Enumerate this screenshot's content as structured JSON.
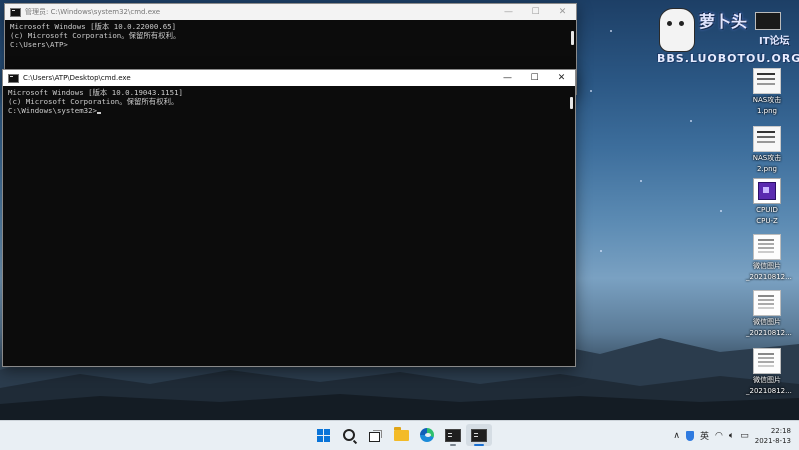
{
  "desktop": {
    "logo": {
      "title": "萝卜头",
      "forum": "IT论坛",
      "url": "BBS.LUOBOTOU.ORG"
    },
    "icons": [
      {
        "label_line1": "NAS攻击",
        "label_line2": "1.png",
        "type": "nas"
      },
      {
        "label_line1": "NAS攻击",
        "label_line2": "2.png",
        "type": "nas"
      },
      {
        "label_line1": "CPUID",
        "label_line2": "CPU-Z",
        "type": "cpu"
      },
      {
        "label_line1": "微信图片",
        "label_line2": "_20210812...",
        "type": "doc"
      },
      {
        "label_line1": "微信图片",
        "label_line2": "_20210812...",
        "type": "doc"
      },
      {
        "label_line1": "微信图片",
        "label_line2": "_20210812...",
        "type": "doc"
      }
    ]
  },
  "windows": {
    "back": {
      "title": "管理员: C:\\Windows\\system32\\cmd.exe",
      "lines": [
        "Microsoft Windows [版本 10.0.22000.65]",
        "(c) Microsoft Corporation。保留所有权利。",
        "",
        "C:\\Users\\ATP>"
      ],
      "controls": {
        "minimize": "—",
        "maximize": "☐",
        "close": "✕"
      }
    },
    "front": {
      "title": "C:\\Users\\ATP\\Desktop\\cmd.exe",
      "lines": [
        "Microsoft Windows [版本 10.0.19043.1151]",
        "(c) Microsoft Corporation。保留所有权利。",
        "C:\\Windows\\system32>"
      ],
      "controls": {
        "minimize": "—",
        "maximize": "☐",
        "close": "✕"
      }
    }
  },
  "taskbar": {
    "apps": [
      "start",
      "search",
      "task-view",
      "file-explorer",
      "edge",
      "terminal",
      "cmd"
    ],
    "tray": {
      "chevron": "∧",
      "ime": "英",
      "time": "22:18",
      "date": "2021-8-13"
    }
  },
  "colors": {
    "accent": "#0a74d8",
    "console_bg": "#0c0c0c",
    "console_text": "#cccccc",
    "taskbar_bg": "#e9eff4"
  }
}
